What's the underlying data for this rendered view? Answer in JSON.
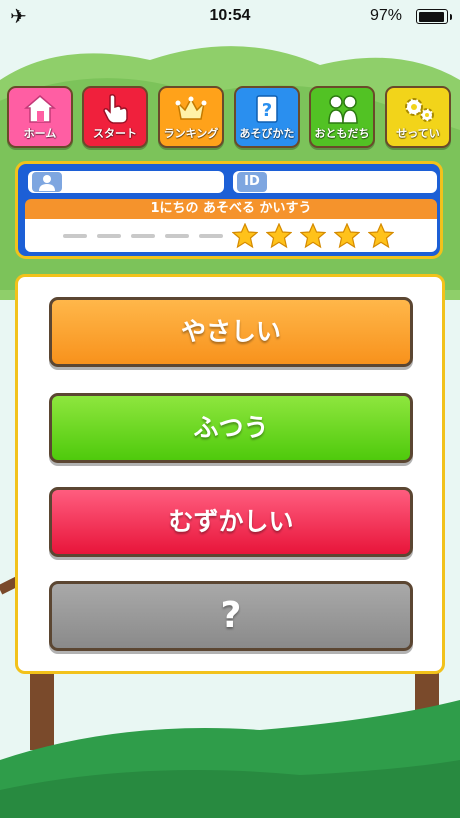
{
  "status_bar": {
    "time": "10:54",
    "battery_percent_text": "97%",
    "battery_level": 0.97,
    "icons": [
      "airplane-icon",
      "battery-icon"
    ]
  },
  "nav": [
    {
      "label": "ホーム",
      "color": "#ff5ea3",
      "icon": "home-icon"
    },
    {
      "label": "スタート",
      "color": "#f0203c",
      "icon": "pointing-hand-icon"
    },
    {
      "label": "ランキング",
      "color": "#ffa21a",
      "icon": "crown-icon"
    },
    {
      "label": "あそびかた",
      "color": "#2a8fef",
      "icon": "question-icon"
    },
    {
      "label": "おともだち",
      "color": "#52c224",
      "icon": "friends-icon"
    },
    {
      "label": "せってい",
      "color": "#f2d41a",
      "icon": "gears-icon"
    }
  ],
  "info": {
    "user_name": "",
    "id_label": "ID",
    "id_value": "",
    "plays_label": "1にちの あそべる かいすう",
    "plays_remaining": 5,
    "plays_max": 10,
    "icons": [
      "user-icon",
      "star-icon"
    ]
  },
  "difficulty": {
    "easy_label": "やさしい",
    "normal_label": "ふつう",
    "hard_label": "むずかしい",
    "secret_label": "?"
  },
  "colors": {
    "panel_border": "#f2c21b",
    "info_bg": "#1c5fd6",
    "plays_bar": "#f5932c",
    "easy": "#f8921c",
    "normal": "#4fca0c",
    "hard": "#e8153a",
    "secret": "#8a8a8a"
  }
}
